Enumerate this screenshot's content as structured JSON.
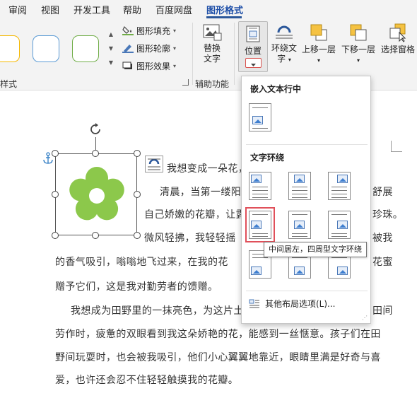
{
  "menu_tabs": [
    "审阅",
    "视图",
    "开发工具",
    "帮助",
    "百度网盘",
    "图形格式"
  ],
  "ribbon": {
    "styles_group_label": "样式",
    "swatch_colors": [
      "#f5b800",
      "#5b9bd5",
      "#70ad47"
    ],
    "format_items": [
      "图形填充",
      "图形轮廓",
      "图形效果"
    ],
    "accessibility_group_label": "辅助功能",
    "alt_text": [
      "替换",
      "文字"
    ],
    "position": "位置",
    "wrap_text": [
      "环绕文",
      "字"
    ],
    "bring_forward": "上移一层",
    "send_backward": "下移一层",
    "selection_pane": "选择窗格"
  },
  "document": {
    "lines": [
      "我想变成一朵花，",
      "清晨，当第一缕阳",
      "舒展",
      "自己娇嫩的花瓣，让露",
      "珍珠。",
      "微风轻拂，我轻轻摇",
      "被我",
      "的香气吸引，嗡嗡地飞过来，在我的花",
      "花蜜",
      "赠予它们，这是我对勤劳者的馈赠。",
      "我想成为田野里的一抹亮色，为这片土",
      "田间",
      "劳作时，疲惫的双眼看到我这朵娇艳的花，能感到一丝惬意。孩子们在田",
      "野间玩耍时，也会被我吸引，他们小心翼翼地靠近，眼睛里满是好奇与喜",
      "爱，也许还会忍不住轻轻触摸我的花瓣。"
    ],
    "flower_color": "#8cc84b"
  },
  "dropdown": {
    "inline_header": "嵌入文本行中",
    "wrap_header": "文字环绕",
    "more_options": "其他布局选项(L)...",
    "tooltip": "中间居左，四周型文字环绕"
  },
  "colors": {
    "accent": "#2b579a",
    "highlight": "#e0505a"
  }
}
